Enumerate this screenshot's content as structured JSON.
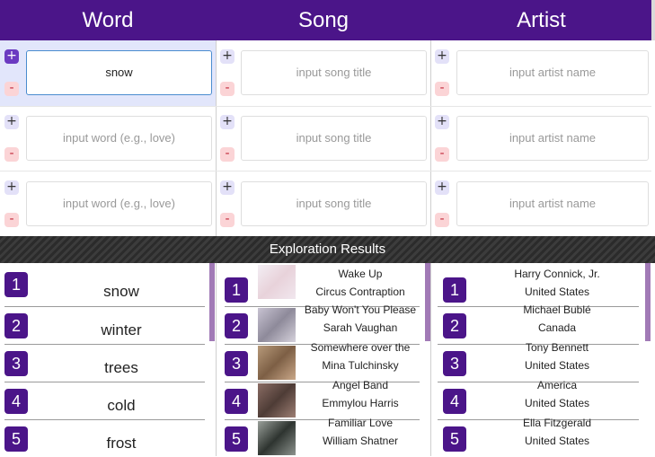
{
  "header": {
    "word": "Word",
    "song": "Song",
    "artist": "Artist"
  },
  "inputs": {
    "word_rows": [
      {
        "value": "snow",
        "placeholder": ""
      },
      {
        "value": "",
        "placeholder": "input word (e.g., love)"
      },
      {
        "value": "",
        "placeholder": "input word (e.g., love)"
      }
    ],
    "song_placeholder": "input song title",
    "artist_placeholder": "input artist name",
    "plus_label": "+",
    "minus_label": "-"
  },
  "results_title": "Exploration Results",
  "results": {
    "words": [
      {
        "rank": "1",
        "text": "snow"
      },
      {
        "rank": "2",
        "text": "winter"
      },
      {
        "rank": "3",
        "text": "trees"
      },
      {
        "rank": "4",
        "text": "cold"
      },
      {
        "rank": "5",
        "text": "frost"
      }
    ],
    "songs": [
      {
        "rank": "1",
        "title": "Wake Up",
        "artist": "Circus Contraption"
      },
      {
        "rank": "2",
        "title": "Baby Won't You Please",
        "artist": "Sarah Vaughan"
      },
      {
        "rank": "3",
        "title": "Somewhere over the",
        "artist": "Mina Tulchinsky"
      },
      {
        "rank": "4",
        "title": "Angel Band",
        "artist": "Emmylou Harris"
      },
      {
        "rank": "5",
        "title": "Familiar Love",
        "artist": "William Shatner"
      }
    ],
    "artists": [
      {
        "rank": "1",
        "name": "Harry Connick, Jr.",
        "country": "United States"
      },
      {
        "rank": "2",
        "name": "Michael Bublé",
        "country": "Canada"
      },
      {
        "rank": "3",
        "name": "Tony Bennett",
        "country": "United States"
      },
      {
        "rank": "4",
        "name": "America",
        "country": "United States"
      },
      {
        "rank": "5",
        "name": "Ella Fitzgerald",
        "country": "United States"
      }
    ]
  },
  "colors": {
    "header_bg": "#4b1589",
    "accent": "#4b1589",
    "plus_active": "#6b3ac1",
    "minus_bg": "#fbd4d6",
    "scrollbar": "#a17ab6"
  }
}
